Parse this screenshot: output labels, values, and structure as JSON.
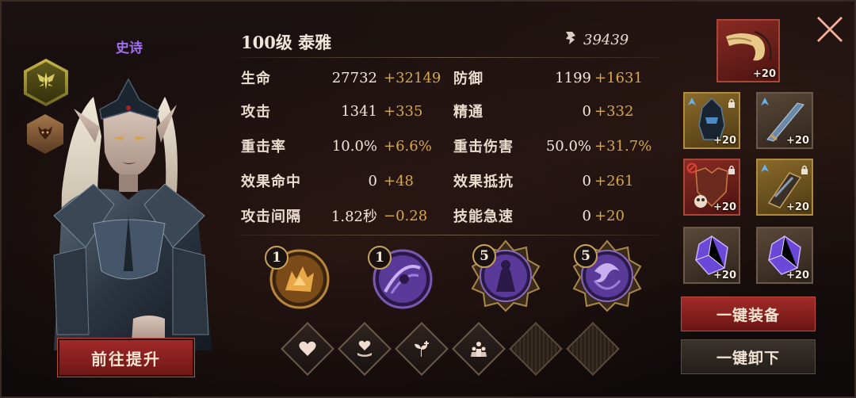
{
  "hero": {
    "rarity": "史诗",
    "level_name": "100级  泰雅",
    "promote_label": "前往提升"
  },
  "power": {
    "value": "39439"
  },
  "stats": {
    "hp": {
      "label": "生命",
      "base": "27732",
      "bonus": "+32149"
    },
    "def": {
      "label": "防御",
      "base": "1199",
      "bonus": "+1631"
    },
    "atk": {
      "label": "攻击",
      "base": "1341",
      "bonus": "+335"
    },
    "mastery": {
      "label": "精通",
      "base": "0",
      "bonus": "+332"
    },
    "crit_rate": {
      "label": "重击率",
      "base": "10.0%",
      "bonus": "+6.6%"
    },
    "crit_dmg": {
      "label": "重击伤害",
      "base": "50.0%",
      "bonus": "+31.7%"
    },
    "effect_hit": {
      "label": "效果命中",
      "base": "0",
      "bonus": "+48"
    },
    "effect_res": {
      "label": "效果抵抗",
      "base": "0",
      "bonus": "+261"
    },
    "atk_interval": {
      "label": "攻击间隔",
      "base": "1.82秒",
      "bonus": "−0.28"
    },
    "skill_haste": {
      "label": "技能急速",
      "base": "0",
      "bonus": "+20"
    }
  },
  "skills": [
    {
      "level": "1",
      "icon": "wolf-fire-skill-icon",
      "color": "#c8802a"
    },
    {
      "level": "1",
      "icon": "shadow-slash-skill-icon",
      "color": "#7a50c8"
    },
    {
      "level": "5",
      "icon": "dark-ritual-skill-icon",
      "color": "#6a40b8"
    },
    {
      "level": "5",
      "icon": "void-vortex-skill-icon",
      "color": "#6a40b8"
    }
  ],
  "runes": [
    {
      "icon": "heart-icon"
    },
    {
      "icon": "heart-hand-icon"
    },
    {
      "icon": "sprout-plus-icon"
    },
    {
      "icon": "group-icon"
    },
    {
      "icon": "empty-slot-icon"
    },
    {
      "icon": "empty-slot-icon"
    }
  ],
  "equipment": {
    "accessory": {
      "plus": "+20",
      "icon": "horn-necklace-icon"
    },
    "helmet": {
      "plus": "+20",
      "icon": "helmet-icon"
    },
    "weapon": {
      "plus": "+20",
      "icon": "blade-icon"
    },
    "armor": {
      "plus": "+20",
      "icon": "armor-icon"
    },
    "gloves": {
      "plus": "+20",
      "icon": "gauntlet-icon"
    },
    "gem1": {
      "plus": "+20",
      "icon": "purple-gem-icon"
    },
    "gem2": {
      "plus": "+20",
      "icon": "purple-gem-icon"
    }
  },
  "actions": {
    "equip_all": "一键装备",
    "unequip_all": "一键卸下"
  },
  "colors": {
    "accent_red": "#a42a2a",
    "bonus_gold": "#d6a848",
    "rarity_purple": "#a070f0"
  }
}
